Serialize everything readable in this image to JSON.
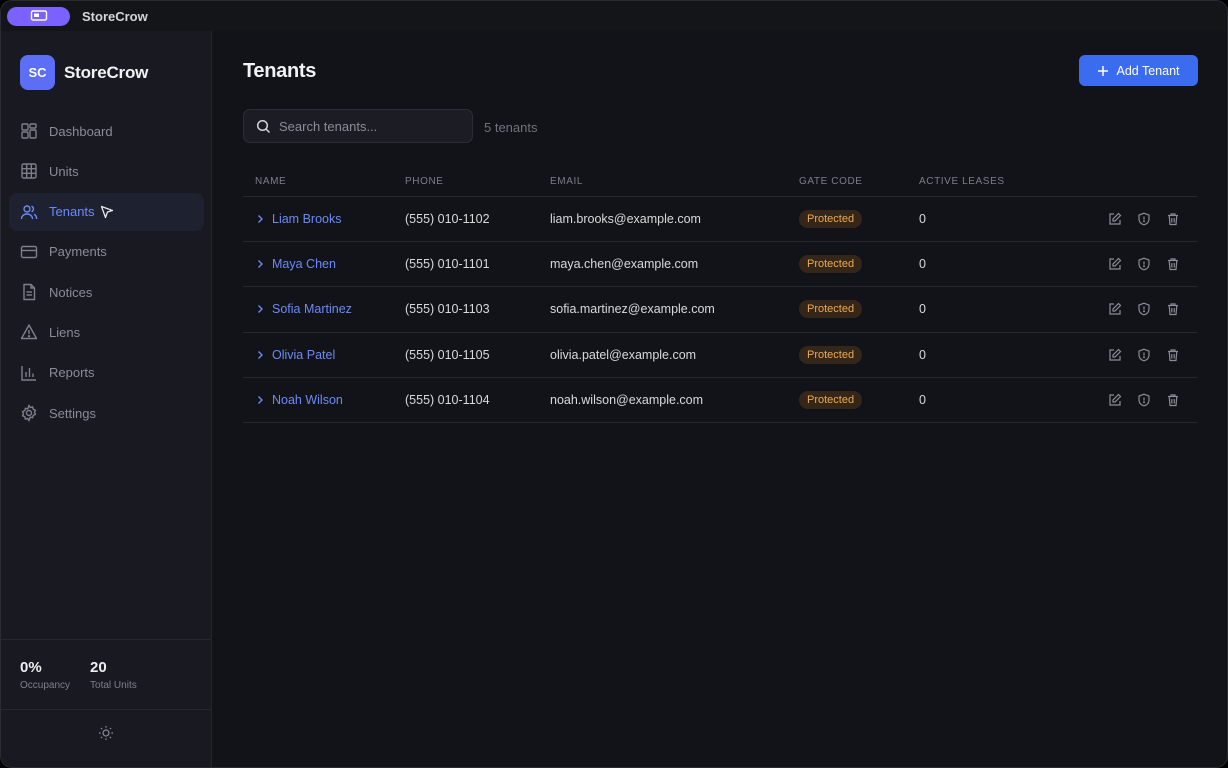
{
  "titlebar": {
    "app_name": "StoreCrow"
  },
  "brand": {
    "logo_text": "SC",
    "name": "StoreCrow"
  },
  "sidebar": {
    "items": [
      {
        "label": "Dashboard",
        "icon": "dashboard-icon",
        "active": false
      },
      {
        "label": "Units",
        "icon": "grid-icon",
        "active": false
      },
      {
        "label": "Tenants",
        "icon": "users-icon",
        "active": true
      },
      {
        "label": "Payments",
        "icon": "credit-card-icon",
        "active": false
      },
      {
        "label": "Notices",
        "icon": "document-icon",
        "active": false
      },
      {
        "label": "Liens",
        "icon": "warning-icon",
        "active": false
      },
      {
        "label": "Reports",
        "icon": "bar-chart-icon",
        "active": false
      },
      {
        "label": "Settings",
        "icon": "gear-icon",
        "active": false
      }
    ],
    "stats": [
      {
        "value": "0%",
        "label": "Occupancy"
      },
      {
        "value": "20",
        "label": "Total Units"
      }
    ]
  },
  "main": {
    "title": "Tenants",
    "add_button": "Add Tenant",
    "search_placeholder": "Search tenants...",
    "count": "5 tenants",
    "columns": [
      "Name",
      "Phone",
      "Email",
      "Gate Code",
      "Active Leases"
    ],
    "rows": [
      {
        "name": "Liam Brooks",
        "phone": "(555) 010-1102",
        "email": "liam.brooks@example.com",
        "gate": "Protected",
        "leases": "0"
      },
      {
        "name": "Maya Chen",
        "phone": "(555) 010-1101",
        "email": "maya.chen@example.com",
        "gate": "Protected",
        "leases": "0"
      },
      {
        "name": "Sofia Martinez",
        "phone": "(555) 010-1103",
        "email": "sofia.martinez@example.com",
        "gate": "Protected",
        "leases": "0"
      },
      {
        "name": "Olivia Patel",
        "phone": "(555) 010-1105",
        "email": "olivia.patel@example.com",
        "gate": "Protected",
        "leases": "0"
      },
      {
        "name": "Noah Wilson",
        "phone": "(555) 010-1104",
        "email": "noah.wilson@example.com",
        "gate": "Protected",
        "leases": "0"
      }
    ]
  },
  "colors": {
    "accent": "#3b6cf0",
    "link": "#6b8af8",
    "brand_logo": "#5b6ef5",
    "app_pill": "#7b61ff",
    "badge_text": "#f0a94a",
    "badge_bg": "#35261a"
  }
}
